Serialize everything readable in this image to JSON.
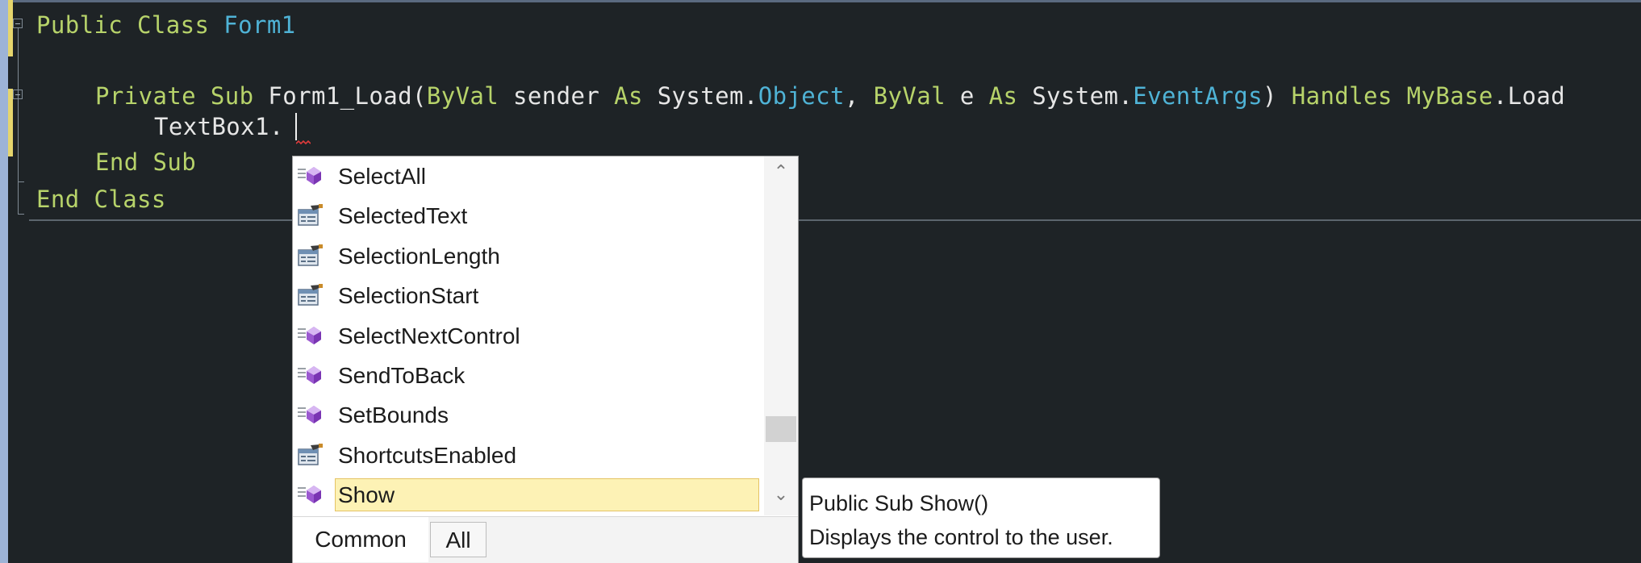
{
  "editor": {
    "lines": {
      "l1": {
        "kw1": "Public",
        "kw2": "Class",
        "name": "Form1"
      },
      "l2": {
        "private": "Private",
        "sub": "Sub",
        "method": "Form1_Load(",
        "byval1": "ByVal",
        "sender": "sender",
        "as1": "As",
        "sys1": "System.",
        "object": "Object",
        "comma": ",",
        "byval2": "ByVal",
        "e": "e",
        "as2": "As",
        "sys2": "System.",
        "eventargs": "EventArgs",
        "close": ")",
        "handles": "Handles",
        "mybase": "MyBase",
        "load": ".Load"
      },
      "l3": {
        "text": "TextBox1."
      },
      "l4": {
        "end": "End",
        "sub": "Sub"
      },
      "l5": {
        "end": "End",
        "class": "Class"
      }
    },
    "colors": {
      "background": "#1e2326",
      "keyword": "#b7d36a",
      "type": "#4fb3d6",
      "text": "#e6e6e6"
    }
  },
  "completion": {
    "items": [
      {
        "label": "SelectAll",
        "icon": "method-icon"
      },
      {
        "label": "SelectedText",
        "icon": "property-icon"
      },
      {
        "label": "SelectionLength",
        "icon": "property-icon"
      },
      {
        "label": "SelectionStart",
        "icon": "property-icon"
      },
      {
        "label": "SelectNextControl",
        "icon": "method-icon"
      },
      {
        "label": "SendToBack",
        "icon": "method-icon"
      },
      {
        "label": "SetBounds",
        "icon": "method-icon"
      },
      {
        "label": "ShortcutsEnabled",
        "icon": "property-icon"
      },
      {
        "label": "Show",
        "icon": "method-icon",
        "selected": true
      }
    ],
    "tabs": {
      "common": "Common",
      "all": "All"
    },
    "scroll_up": "⌃",
    "scroll_down": "⌄"
  },
  "tooltip": {
    "signature": "Public Sub Show()",
    "description": "Displays the control to the user."
  }
}
